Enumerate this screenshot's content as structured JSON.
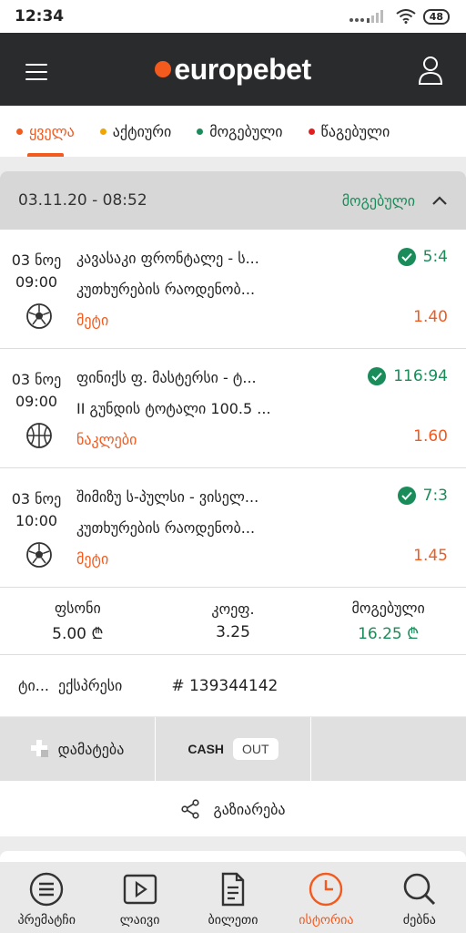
{
  "status_bar": {
    "time": "12:34",
    "signal": "... ",
    "battery": "48"
  },
  "header": {
    "brand": "europebet",
    "colors": {
      "brand": "#f25a1e",
      "bar": "#2a2b2d"
    }
  },
  "filters": [
    {
      "label": "ყველა",
      "color": "#f25a1e",
      "active": true
    },
    {
      "label": "აქტიური",
      "color": "#f0a500",
      "active": false
    },
    {
      "label": "მოგებული",
      "color": "#1a8c5a",
      "active": false
    },
    {
      "label": "წაგებული",
      "color": "#e02020",
      "active": false
    }
  ],
  "ticket": {
    "date": "03.11.20 - 08:52",
    "status": "მოგებული",
    "events": [
      {
        "day": "03 ნოე",
        "time": "09:00",
        "sport_icon": "football-icon",
        "name": "კავასაკი ფრონტალე - ს...",
        "market": "კუთხურების რაოდენობ...",
        "pick": "მეტი",
        "score": "5:4",
        "odds": "1.40"
      },
      {
        "day": "03 ნოე",
        "time": "09:00",
        "sport_icon": "basketball-icon",
        "name": "ფინიქს ფ. მასტერსი - ტ...",
        "market": "II გუნდის ტოტალი 100.5 ...",
        "pick": "ნაკლები",
        "score": "116:94",
        "odds": "1.60"
      },
      {
        "day": "03 ნოე",
        "time": "10:00",
        "sport_icon": "football-icon",
        "name": "შიმიზუ ს-პულსი - ვისელ...",
        "market": "კუთხურების რაოდენობ...",
        "pick": "მეტი",
        "score": "7:3",
        "odds": "1.45"
      }
    ],
    "summary": {
      "stake_label": "ფსონი",
      "stake_value": "5.00 ₾",
      "coef_label": "კოეფ.",
      "coef_value": "3.25",
      "win_label": "მოგებული",
      "win_value": "16.25 ₾"
    },
    "type_label": "ტი...",
    "type_value": "ექსპრესი",
    "number": "# 139344142",
    "actions": {
      "add": "დამატება",
      "cash": "CASH",
      "out": "OUT"
    },
    "share": "გაზიარება"
  },
  "bottom_nav": [
    {
      "label": "პრემატჩი",
      "icon": "list-icon",
      "active": false
    },
    {
      "label": "ლაივი",
      "icon": "play-icon",
      "active": false
    },
    {
      "label": "ბილეთი",
      "icon": "ticket-icon",
      "active": false
    },
    {
      "label": "ისტორია",
      "icon": "clock-icon",
      "active": true
    },
    {
      "label": "ძებნა",
      "icon": "search-icon",
      "active": false
    }
  ]
}
